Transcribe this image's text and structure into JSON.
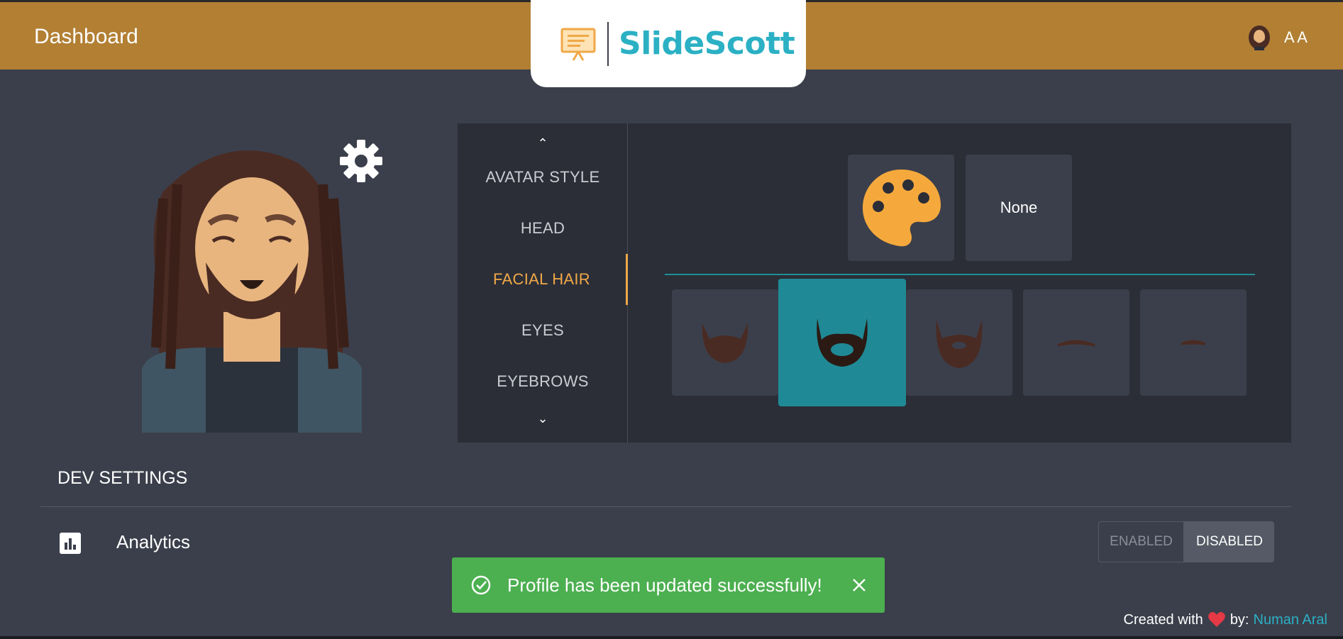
{
  "header": {
    "title": "Dashboard",
    "brand": "SlideScott",
    "user_initials": "A A",
    "accent_color": "#b27f33"
  },
  "editor": {
    "menu": [
      {
        "label": "AVATAR STYLE",
        "active": false
      },
      {
        "label": "HEAD",
        "active": false
      },
      {
        "label": "FACIAL HAIR",
        "active": true
      },
      {
        "label": "EYES",
        "active": false
      },
      {
        "label": "EYEBROWS",
        "active": false
      }
    ],
    "none_label": "None",
    "facial_hair_options": [
      {
        "icon": "full-beard-icon",
        "selected": false
      },
      {
        "icon": "goatee-beard-icon",
        "selected": true
      },
      {
        "icon": "majestic-beard-icon",
        "selected": false
      },
      {
        "icon": "moustache-icon",
        "selected": false
      },
      {
        "icon": "small-moustache-icon",
        "selected": false
      }
    ]
  },
  "dev_settings": {
    "title": "DEV SETTINGS",
    "analytics_label": "Analytics",
    "enabled_label": "ENABLED",
    "disabled_label": "DISABLED",
    "selected": "DISABLED"
  },
  "toast": {
    "message": "Profile has been updated successfully!",
    "color": "#4caf50"
  },
  "footer": {
    "prefix": "Created with",
    "by": "by:",
    "author": "Numan Aral"
  }
}
